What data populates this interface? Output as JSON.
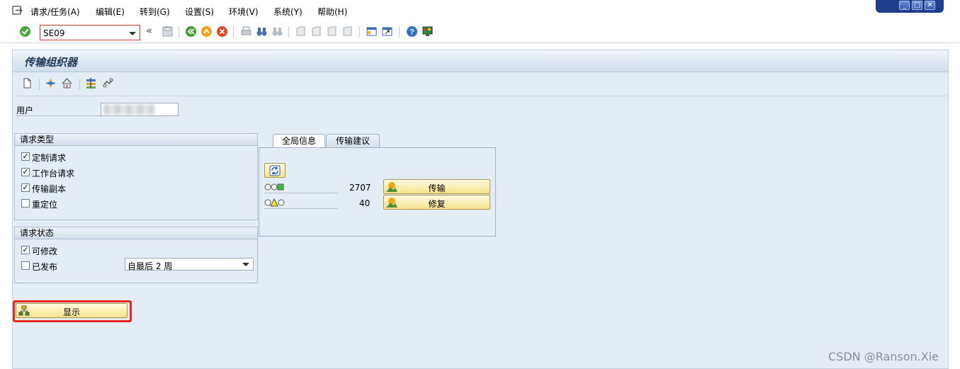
{
  "menubar": {
    "items": [
      "请求/任务(A)",
      "编辑(E)",
      "转到(G)",
      "设置(S)",
      "环境(V)",
      "系统(Y)",
      "帮助(H)"
    ]
  },
  "toolbar": {
    "command_value": "SE09"
  },
  "screen": {
    "title": "传输组织器"
  },
  "user": {
    "label": "用户"
  },
  "request_type": {
    "title": "请求类型",
    "options": [
      {
        "label": "定制请求",
        "checked": true
      },
      {
        "label": "工作台请求",
        "checked": true
      },
      {
        "label": "传输副本",
        "checked": true
      },
      {
        "label": "重定位",
        "checked": false
      }
    ]
  },
  "request_status": {
    "title": "请求状态",
    "modifiable": {
      "label": "可修改",
      "checked": true
    },
    "released": {
      "label": "已发布",
      "checked": false
    },
    "period": "自最后 2 周"
  },
  "tabs": {
    "global_info": "全局信息",
    "transport_proposal": "传输建议"
  },
  "stats": {
    "transport_count": "2707",
    "transport_button": "传输",
    "repair_count": "40",
    "repair_button": "修复"
  },
  "display_button": "显示",
  "watermark": "CSDN @Ranson.Xie",
  "colors": {
    "highlight_border": "#e6261f",
    "button_yellow": "#f8e38d",
    "background": "#e4ecf5"
  }
}
